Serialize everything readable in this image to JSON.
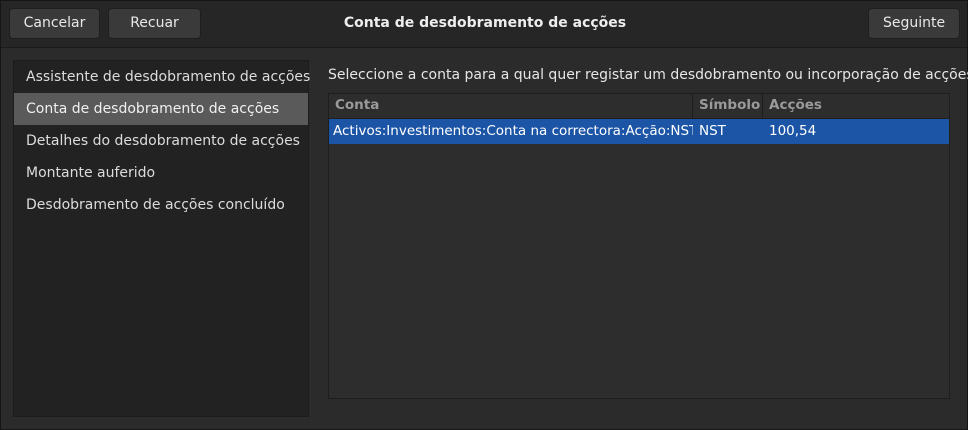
{
  "header": {
    "title": "Conta de desdobramento de acções",
    "cancel_label": "Cancelar",
    "back_label": "Recuar",
    "next_label": "Seguinte"
  },
  "sidebar": {
    "items": [
      {
        "label": "Assistente de desdobramento de acções",
        "selected": false
      },
      {
        "label": "Conta de desdobramento de acções",
        "selected": true
      },
      {
        "label": "Detalhes do desdobramento de acções",
        "selected": false
      },
      {
        "label": "Montante auferido",
        "selected": false
      },
      {
        "label": "Desdobramento de acções concluído",
        "selected": false
      }
    ]
  },
  "main": {
    "instruction": "Seleccione a conta para a qual quer registar um desdobramento ou incorporação de acções.",
    "table": {
      "columns": [
        "Conta",
        "Símbolo",
        "Acções"
      ],
      "rows": [
        {
          "account": "Activos:Investimentos:Conta na correctora:Acção:NST",
          "symbol": "NST",
          "shares": "100,54",
          "selected": true
        }
      ]
    }
  },
  "colors": {
    "selection": "#1c55a6",
    "sidebar_selected": "#5a5a5a",
    "background": "#2b2b2b"
  }
}
